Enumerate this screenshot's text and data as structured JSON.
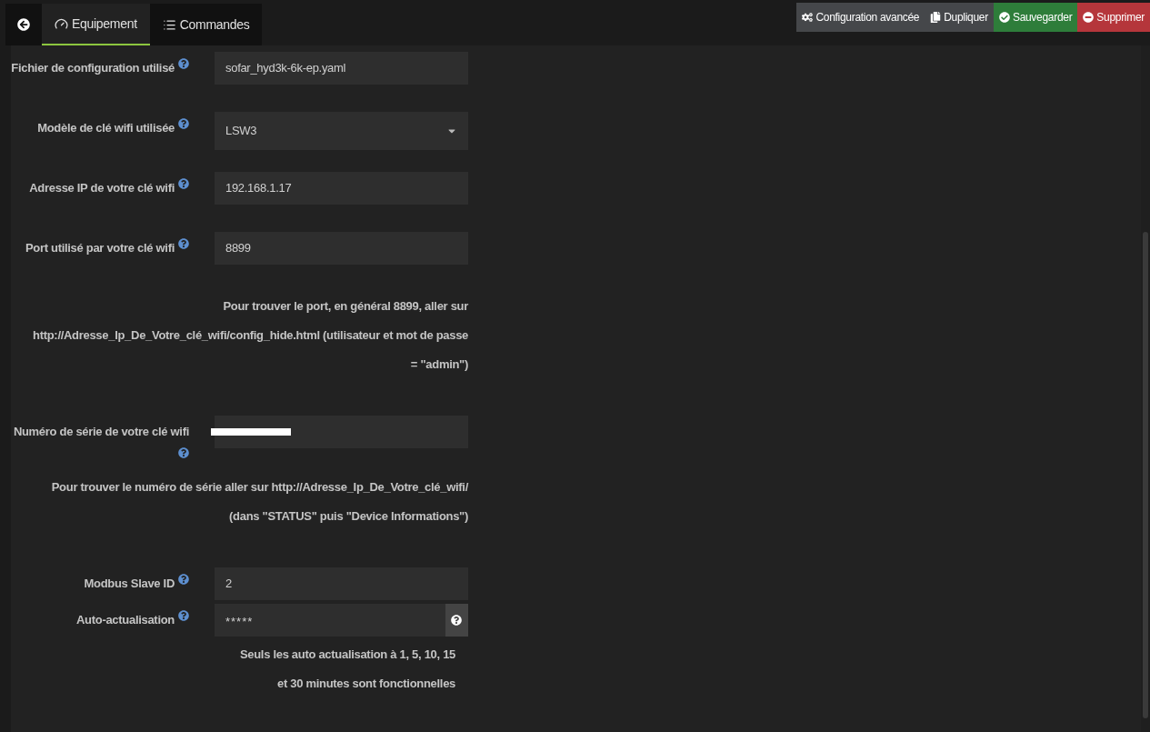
{
  "tabs": [
    {
      "label": "Equipement",
      "selected": true
    },
    {
      "label": "Commandes",
      "selected": false
    }
  ],
  "actions": [
    {
      "label": "Configuration avancée",
      "kind": "config"
    },
    {
      "label": "Dupliquer",
      "kind": "duplicate"
    },
    {
      "label": "Sauvegarder",
      "kind": "save"
    },
    {
      "label": "Supprimer",
      "kind": "delete"
    }
  ],
  "fields": [
    {
      "kind": "text",
      "label": "Fichier de configuration utilisé",
      "value": "sofar_hyd3k-6k-ep.yaml"
    },
    {
      "kind": "select",
      "label": "Modèle de clé wifi utilisée",
      "value": "LSW3"
    },
    {
      "kind": "text",
      "label": "Adresse IP de votre clé wifi",
      "value": "192.168.1.17"
    },
    {
      "kind": "text",
      "label": "Port utilisé par votre clé wifi",
      "value": "8899",
      "note": "Pour trouver le port, en général 8899, aller sur http://Adresse_Ip_De_Votre_clé_wifi/config_hide.html (utilisateur et mot de passe = \"admin\")"
    },
    {
      "kind": "redacted",
      "label": "Numéro de série de votre clé wifi",
      "note": "Pour trouver le numéro de série aller sur http://Adresse_Ip_De_Votre_clé_wifi/ (dans \"STATUS\" puis \"Device Informations\")"
    },
    {
      "kind": "text",
      "label": "Modbus Slave ID",
      "value": "2"
    },
    {
      "kind": "password",
      "label": "Auto-actualisation",
      "value": "*****",
      "note": "Seuls les auto actualisation à 1, 5, 10, 15 et 30 minutes sont fonctionnelles"
    }
  ]
}
